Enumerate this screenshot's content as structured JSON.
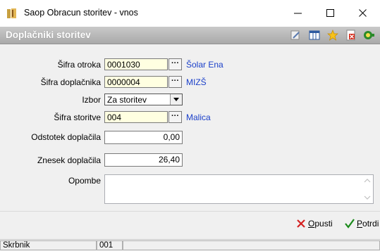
{
  "window": {
    "title": "Saop Obracun storitev - vnos"
  },
  "header": {
    "title": "Doplačniki storitev"
  },
  "form": {
    "sifra_otroka": {
      "label": "Šifra otroka",
      "value": "0001030",
      "link": "Šolar Ena"
    },
    "sifra_doplacnika": {
      "label": "Šifra doplačnika",
      "value": "0000004",
      "link": "MIZŠ"
    },
    "izbor": {
      "label": "Izbor",
      "value": "Za storitev"
    },
    "sifra_storitve": {
      "label": "Šifra storitve",
      "value": "004",
      "link": "Malica"
    },
    "odstotek": {
      "label": "Odstotek doplačila",
      "value": "0,00"
    },
    "znesek": {
      "label": "Znesek doplačila",
      "value": "26,40"
    },
    "opombe": {
      "label": "Opombe",
      "value": ""
    }
  },
  "buttons": {
    "opusti": {
      "label": "Opusti",
      "underline": "O"
    },
    "potrdi": {
      "label": "Potrdi",
      "underline": "P"
    }
  },
  "statusbar": {
    "left": "Skrbnik",
    "middle": "001"
  },
  "colors": {
    "link": "#1a3fc9",
    "field_yellow": "#ffffe1",
    "header_grad": "#b0b0b0"
  }
}
